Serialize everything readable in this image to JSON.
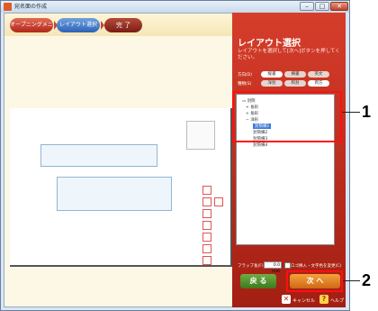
{
  "window": {
    "title": "宛名面の作成"
  },
  "breadcrumb": {
    "step1": "オープニングメニュー",
    "step2": "レイアウト選択",
    "step3": "完 了"
  },
  "panel": {
    "title": "レイアウト選択",
    "description": "レイアウトを選択して[次へ]ボタンを押してください。",
    "direction_label": "方向(D)",
    "direction_options": [
      "縦書",
      "横書",
      "英文"
    ],
    "variant_label": "種類(S)",
    "variant_options": [
      "洋封",
      "和封",
      "両方"
    ]
  },
  "tree": {
    "root": "封筒",
    "items": [
      "長形",
      "角形",
      "洋形"
    ],
    "subitems": [
      "封筒横2",
      "封筒横3",
      "封筒横4"
    ],
    "selected": "封筒横1"
  },
  "flap": {
    "label": "フラップ長(F)",
    "value": "0.0 mm",
    "checkbox_label": "ロゴ挿入・文字色を変更(C)"
  },
  "buttons": {
    "back": "戻 る",
    "next": "次 へ",
    "cancel": "キャンセル",
    "help": "ヘルプ"
  },
  "callouts": {
    "first": "1",
    "second": "2"
  },
  "colors": {
    "panel_red": "#c42d1f",
    "next_orange": "#e57d1f",
    "back_green": "#4f8f2a",
    "highlight": "#ff1010"
  }
}
